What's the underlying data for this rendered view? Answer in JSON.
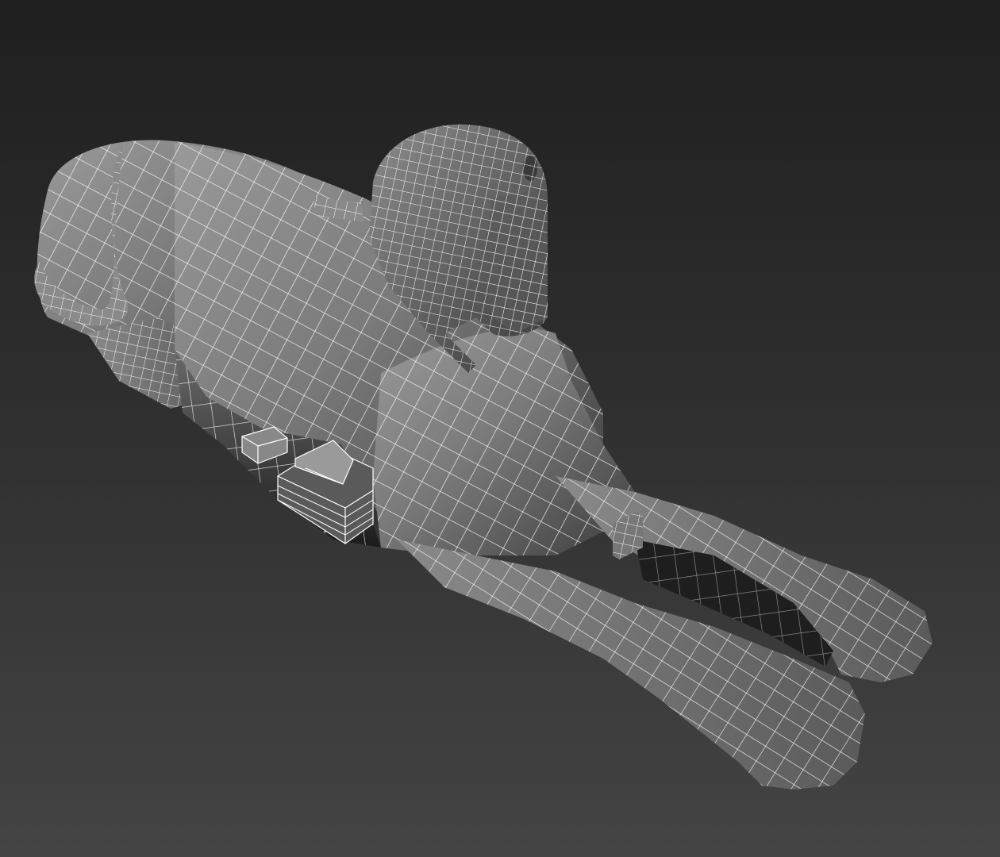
{
  "viewport": {
    "background_top": "#1f1f1f",
    "background_bottom": "#444444",
    "shading": "default-shading-with-edged-faces"
  },
  "model": {
    "subject": "sphinx",
    "display_mode": "wireframe-over-shaded",
    "surface_color": "#7a7a7a",
    "wire_color": "#ffffff"
  }
}
